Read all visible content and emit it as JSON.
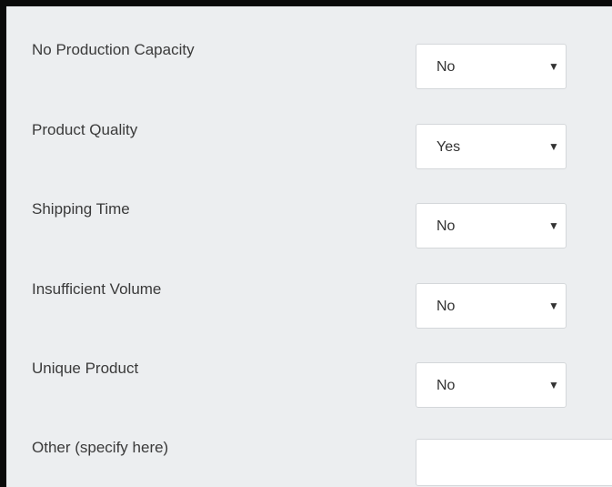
{
  "form": {
    "fields": [
      {
        "label": "No Production Capacity",
        "value": "No",
        "arrow": "▼"
      },
      {
        "label": "Product Quality",
        "value": "Yes",
        "arrow": "▼"
      },
      {
        "label": "Shipping Time",
        "value": "No",
        "arrow": "▼"
      },
      {
        "label": "Insufficient Volume",
        "value": "No",
        "arrow": "▼"
      },
      {
        "label": "Unique Product",
        "value": "No",
        "arrow": "▼"
      }
    ],
    "other": {
      "label": "Other (specify here)",
      "value": "",
      "placeholder": ""
    }
  },
  "colors": {
    "background": "#eceef0",
    "frame_border": "#0a0a0a",
    "field_background": "#ffffff",
    "field_border": "#d4d7da",
    "label_text": "#3a3a3a"
  },
  "icons": {
    "dropdown": "caret-down-icon"
  }
}
